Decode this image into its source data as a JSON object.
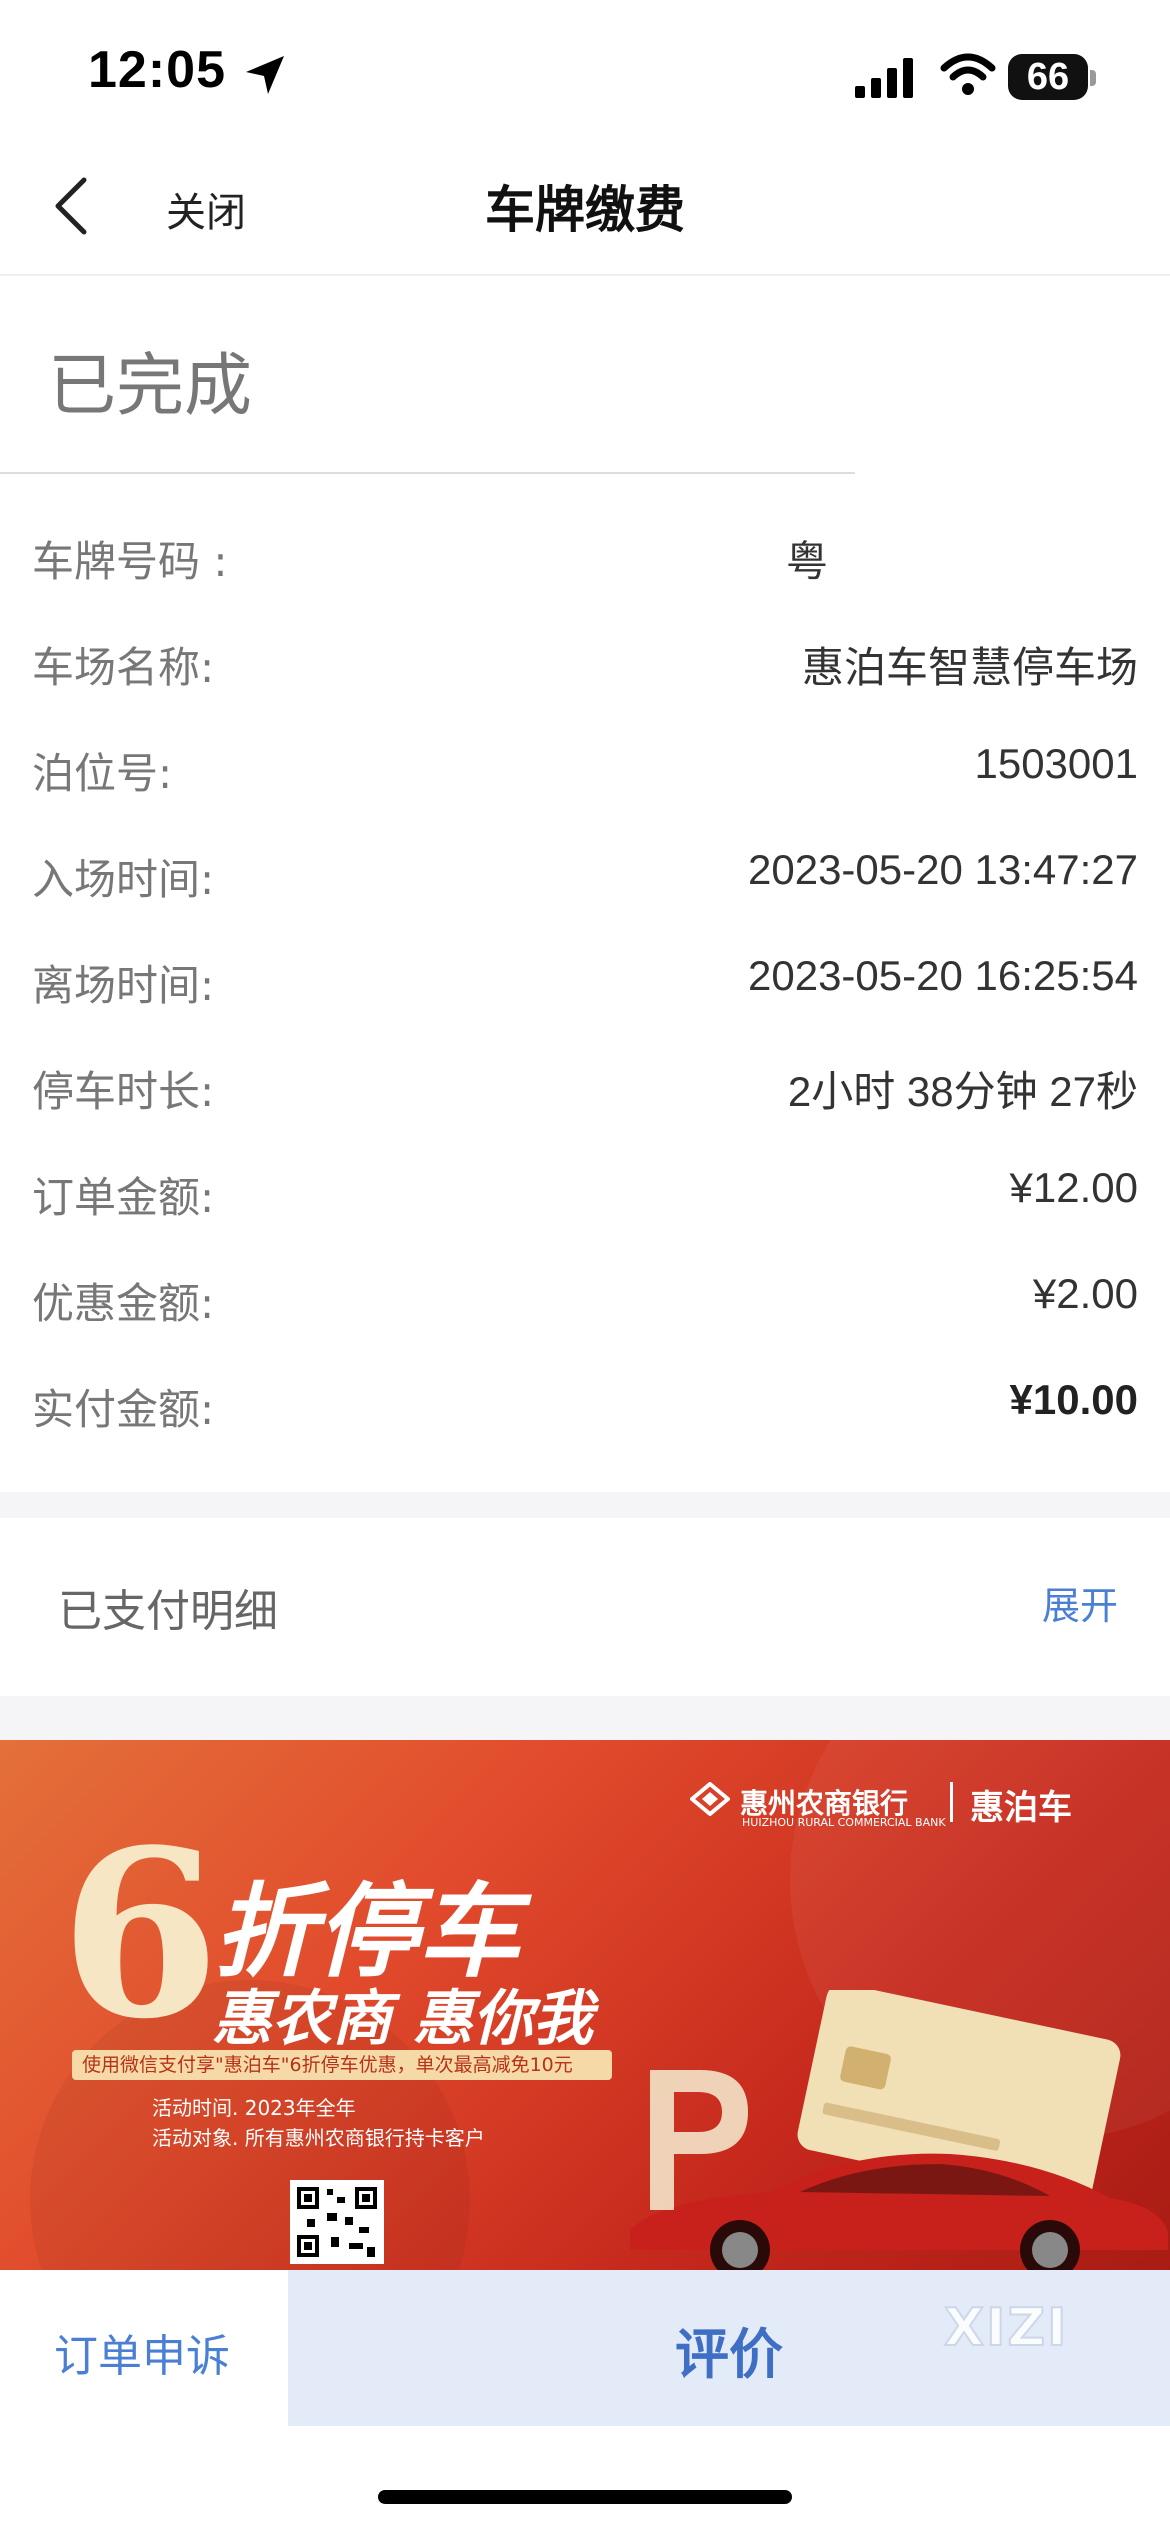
{
  "status_bar": {
    "time": "12:05",
    "battery": "66"
  },
  "nav": {
    "close_label": "关闭",
    "title": "车牌缴费"
  },
  "order": {
    "status": "已完成"
  },
  "details": [
    {
      "label": "车牌号码 :",
      "value": "粤",
      "bold": false
    },
    {
      "label": "车场名称:",
      "value": "惠泊车智慧停车场",
      "bold": false
    },
    {
      "label": "泊位号:",
      "value": "1503001",
      "bold": false
    },
    {
      "label": "入场时间:",
      "value": "2023-05-20 13:47:27",
      "bold": false
    },
    {
      "label": "离场时间:",
      "value": "2023-05-20 16:25:54",
      "bold": false
    },
    {
      "label": "停车时长:",
      "value": "2小时 38分钟 27秒",
      "bold": false
    },
    {
      "label": "订单金额:",
      "value": "¥12.00",
      "bold": false
    },
    {
      "label": "优惠金额:",
      "value": "¥2.00",
      "bold": false
    },
    {
      "label": "实付金额:",
      "value": "¥10.00",
      "bold": true
    }
  ],
  "paid_detail": {
    "label": "已支付明细",
    "toggle": "展开"
  },
  "banner": {
    "bank_name": "惠州农商银行",
    "bank_name_en": "HUIZHOU RURAL COMMERCIAL BANK",
    "brand": "惠泊车",
    "big_number": "6",
    "title": "折停车",
    "subtitle": "惠农商 惠你我",
    "note": "使用微信支付享\"惠泊车\"6折停车优惠，单次最高减免10元",
    "activity_time": "活动时间. 2023年全年",
    "activity_target": "活动对象. 所有惠州农商银行持卡客户"
  },
  "bottom": {
    "complain_label": "订单申诉",
    "rate_label": "评价",
    "watermark": "XIZI"
  },
  "colors": {
    "accent": "#4a7fd3",
    "rate_bg": "#e3ebf8",
    "banner_red": "#d23a24"
  }
}
